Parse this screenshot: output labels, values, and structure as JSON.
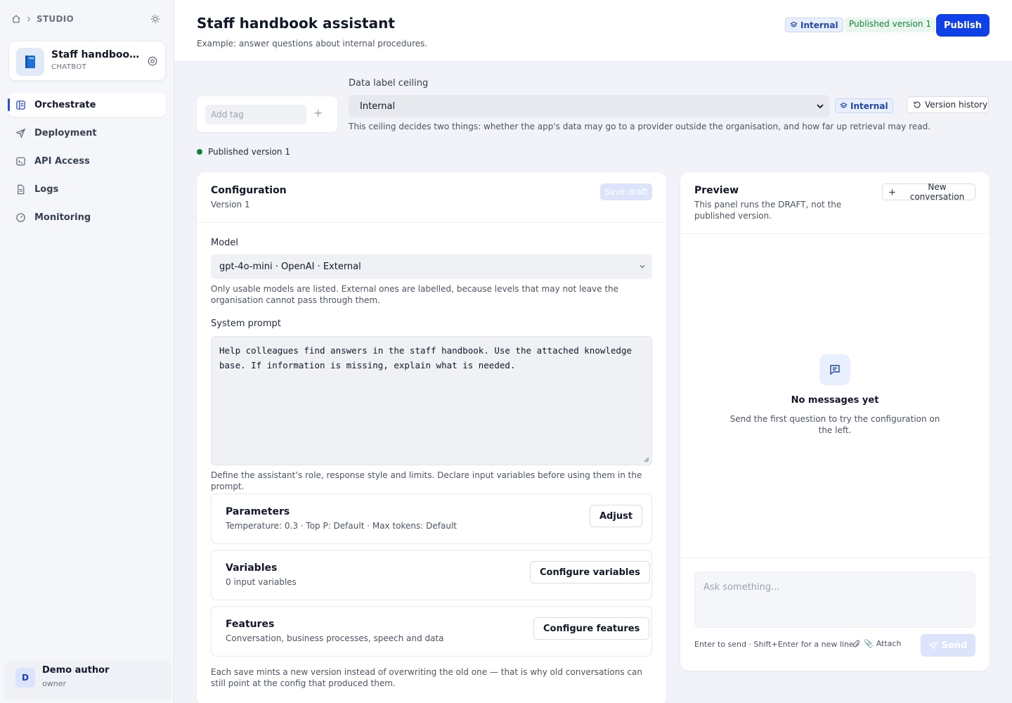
{
  "sidebar": {
    "breadcrumb": "STUDIO",
    "app": {
      "name": "Staff handbook ...",
      "type": "CHATBOT"
    },
    "nav": [
      {
        "label": "Orchestrate",
        "icon": "layout-icon",
        "active": true
      },
      {
        "label": "Deployment",
        "icon": "send-icon",
        "active": false
      },
      {
        "label": "API Access",
        "icon": "terminal-icon",
        "active": false
      },
      {
        "label": "Logs",
        "icon": "file-icon",
        "active": false
      },
      {
        "label": "Monitoring",
        "icon": "gauge-icon",
        "active": false
      }
    ],
    "user": {
      "initial": "D",
      "name": "Demo author",
      "role": "owner"
    }
  },
  "header": {
    "title": "Staff handbook assistant",
    "subtitle": "Example: answer questions about internal procedures.",
    "badge_internal": "Internal",
    "badge_published": "Published version 1",
    "publish_label": "Publish"
  },
  "toolbar": {
    "tag_placeholder": "Add tag",
    "tag_add": "+",
    "ceiling_label": "Data label ceiling",
    "ceiling_value": "Internal",
    "ceiling_badge": "Internal",
    "ceiling_help": "This ceiling decides two things: whether the app's data may go to a provider outside the organisation, and how far up retrieval may read.",
    "version_history_label": "Version history",
    "status": "Published version 1"
  },
  "config": {
    "title": "Configuration",
    "version": "Version 1",
    "save_label": "Save draft",
    "model_label": "Model",
    "model_value": "gpt-4o-mini · OpenAI · External",
    "model_help": "Only usable models are listed. External ones are labelled, because levels that may not leave the organisation cannot pass through them.",
    "prompt_label": "System prompt",
    "prompt_value": "Help colleagues find answers in the staff handbook. Use the attached knowledge base. If information is missing, explain what is needed.",
    "prompt_help": "Define the assistant’s role, response style and limits. Declare input variables before using them in the prompt.",
    "sections": [
      {
        "title": "Parameters",
        "sub": "Temperature: 0.3 · Top P: Default · Max tokens: Default",
        "button": "Adjust"
      },
      {
        "title": "Variables",
        "sub": "0 input variables",
        "button": "Configure variables"
      },
      {
        "title": "Features",
        "sub": "Conversation, business processes, speech and data",
        "button": "Configure features"
      }
    ],
    "footnote": "Each save mints a new version instead of overwriting the old one — that is why old conversations can still point at the config that produced them."
  },
  "preview": {
    "title": "Preview",
    "subtitle": "This panel runs the DRAFT, not the published version.",
    "new_conversation_label": "New conversation",
    "empty_title": "No messages yet",
    "empty_sub": "Send the first question to try the configuration on the left.",
    "input_placeholder": "Ask something...",
    "hint": "Enter to send · Shift+Enter for a new line",
    "attach_label": "Attach",
    "send_label": "Send"
  },
  "colors": {
    "accent": "#1041e6",
    "success": "#15803d",
    "badge_bg": "#e8efff"
  }
}
